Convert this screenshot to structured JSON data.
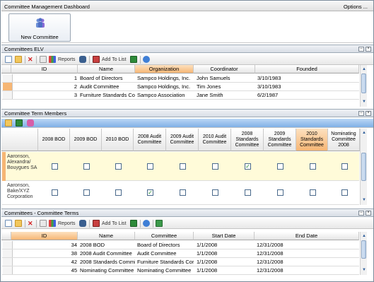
{
  "window": {
    "title": "Committee Management Dashboard",
    "options_label": "Options ..."
  },
  "ribbon": {
    "new_committee_label": "New Committee"
  },
  "committees_elv": {
    "header": "Committees ELV",
    "toolbar": {
      "reports_label": "Reports",
      "add_to_list_label": "Add To List"
    },
    "columns": [
      "ID",
      "Name",
      "Organization",
      "Coordinator",
      "Founded"
    ],
    "rows": [
      {
        "id": "1",
        "name": "Board of Directors",
        "organization": "Sampco Holdings, Inc.",
        "coordinator": "John Samuels",
        "founded": "3/10/1983"
      },
      {
        "id": "2",
        "name": "Audit Committee",
        "organization": "Sampco Holdings, Inc.",
        "coordinator": "Tim Jones",
        "founded": "3/10/1983"
      },
      {
        "id": "3",
        "name": "Furniture Standards Cor",
        "organization": "Sampco Association",
        "coordinator": "Jane Smith",
        "founded": "6/2/1987"
      }
    ]
  },
  "term_members": {
    "header": "Committee Term Members",
    "columns": [
      "2008 BOD",
      "2009 BOD",
      "2010 BOD",
      "2008 Audit Committee",
      "2009 Audit Committee",
      "2010 Audit Committee",
      "2008 Standards Committee",
      "2009 Standards Committee",
      "2010 Standards Committee",
      "Nominating Committee 2008"
    ],
    "rows": [
      {
        "member": "Aaronson, Alexandra/ Bouygues SA",
        "checks": [
          false,
          false,
          false,
          false,
          false,
          false,
          true,
          false,
          false,
          false
        ]
      },
      {
        "member": "Aaronson, Bake/XYZ Corporation",
        "checks": [
          false,
          false,
          false,
          true,
          false,
          false,
          false,
          false,
          false,
          false
        ]
      }
    ]
  },
  "committee_terms": {
    "header": "Committees - Committee Terms",
    "toolbar": {
      "reports_label": "Reports",
      "add_to_list_label": "Add To List"
    },
    "columns": [
      "ID",
      "Name",
      "Committee",
      "Start Date",
      "End Date"
    ],
    "rows": [
      {
        "id": "34",
        "name": "2008 BOD",
        "committee": "Board of Directors",
        "start": "1/1/2008",
        "end": "12/31/2008"
      },
      {
        "id": "38",
        "name": "2008 Audit Committee",
        "committee": "Audit Committee",
        "start": "1/1/2008",
        "end": "12/31/2008"
      },
      {
        "id": "42",
        "name": "2008 Standards Committ",
        "committee": "Furniture Standards Cor",
        "start": "1/1/2008",
        "end": "12/31/2008"
      },
      {
        "id": "45",
        "name": "Nominating Committee 2",
        "committee": "Nominating Committee",
        "start": "1/1/2008",
        "end": "12/31/2008"
      }
    ]
  },
  "colors": {
    "accent_orange": "#f6b675",
    "toolbar_blue": "#7fb0e6",
    "check_green": "#1e8a2a"
  },
  "icons": [
    "committee-people-icon",
    "new-record-icon",
    "open-folder-icon",
    "delete-icon",
    "reports-icon",
    "binoculars-icon",
    "add-to-list-icon",
    "excel-icon",
    "refresh-icon",
    "save-icon",
    "export-icon",
    "eraser-icon"
  ]
}
